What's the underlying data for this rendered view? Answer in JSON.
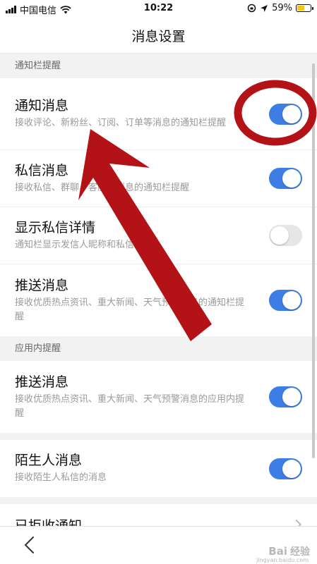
{
  "status_bar": {
    "carrier": "中国电信",
    "time": "10:22",
    "battery": "59%",
    "battery_level": 0.59
  },
  "header": {
    "title": "消息设置"
  },
  "sections": [
    {
      "header": "通知栏提醒",
      "rows": [
        {
          "label": "通知消息",
          "desc": "接收评论、新粉丝、订阅、订单等消息的通知栏提醒",
          "on": true
        },
        {
          "label": "私信消息",
          "desc": "接收私信、群聊、客服等消息的通知栏提醒",
          "on": true
        },
        {
          "label": "显示私信详情",
          "desc": "通知栏显示发信人昵称和私信内容",
          "on": false
        },
        {
          "label": "推送消息",
          "desc": "接收优质热点资讯、重大新闻、天气预警消息的通知栏提醒",
          "on": true
        }
      ]
    },
    {
      "header": "应用内提醒",
      "rows": [
        {
          "label": "推送消息",
          "desc": "接收优质热点资讯、重大新闻、天气预警消息的应用内提醒",
          "on": true
        }
      ]
    }
  ],
  "stranger": {
    "label": "陌生人消息",
    "desc": "接收陌生人私信的消息",
    "on": true
  },
  "rejected": {
    "label": "已拒收通知"
  },
  "annotation": {
    "ring_color": "#b31217",
    "arrow_color": "#b31217"
  },
  "watermark": {
    "logo": "Bai",
    "cn": "经验",
    "url": "jingyan.baidu.com"
  },
  "colors": {
    "switch_on": "#3d7ee6",
    "switch_off": "#e6e6e6"
  }
}
